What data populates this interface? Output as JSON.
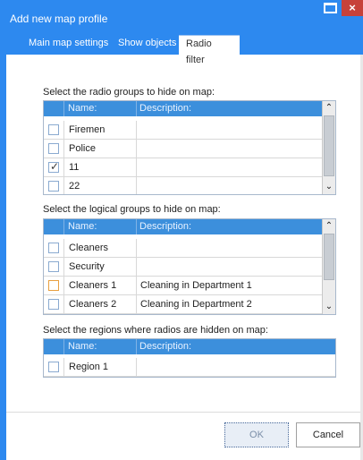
{
  "window": {
    "title": "Add new map profile",
    "close_glyph": "×",
    "accent": "#2d89ef"
  },
  "tabs": [
    {
      "label": "Main map settings",
      "active": false
    },
    {
      "label": "Show objects",
      "active": false
    },
    {
      "label": "Radio filter",
      "active": true
    }
  ],
  "radio_groups": {
    "label": "Select the radio groups to hide on map:",
    "columns": {
      "name": "Name:",
      "description": "Description:"
    },
    "rows": [
      {
        "name": "Firemen",
        "description": "",
        "checked": false
      },
      {
        "name": "Police",
        "description": "",
        "checked": false
      },
      {
        "name": "11",
        "description": "",
        "checked": true
      },
      {
        "name": "22",
        "description": "",
        "checked": false
      }
    ]
  },
  "logical_groups": {
    "label": "Select the logical groups to hide on map:",
    "columns": {
      "name": "Name:",
      "description": "Description:"
    },
    "rows": [
      {
        "name": "Cleaners",
        "description": "",
        "checked": false
      },
      {
        "name": "Security",
        "description": "",
        "checked": false
      },
      {
        "name": "Cleaners 1",
        "description": "Cleaning in Department 1",
        "checked": false
      },
      {
        "name": "Cleaners 2",
        "description": "Cleaning in Department 2",
        "checked": false
      }
    ]
  },
  "regions": {
    "label": "Select the regions where radios are hidden on map:",
    "columns": {
      "name": "Name:",
      "description": "Description:"
    },
    "rows": [
      {
        "name": "Region 1",
        "description": "",
        "checked": false
      }
    ]
  },
  "buttons": {
    "ok": "OK",
    "cancel": "Cancel"
  },
  "check_glyph": "✓",
  "scroll": {
    "up": "⌃",
    "down": "⌄"
  }
}
